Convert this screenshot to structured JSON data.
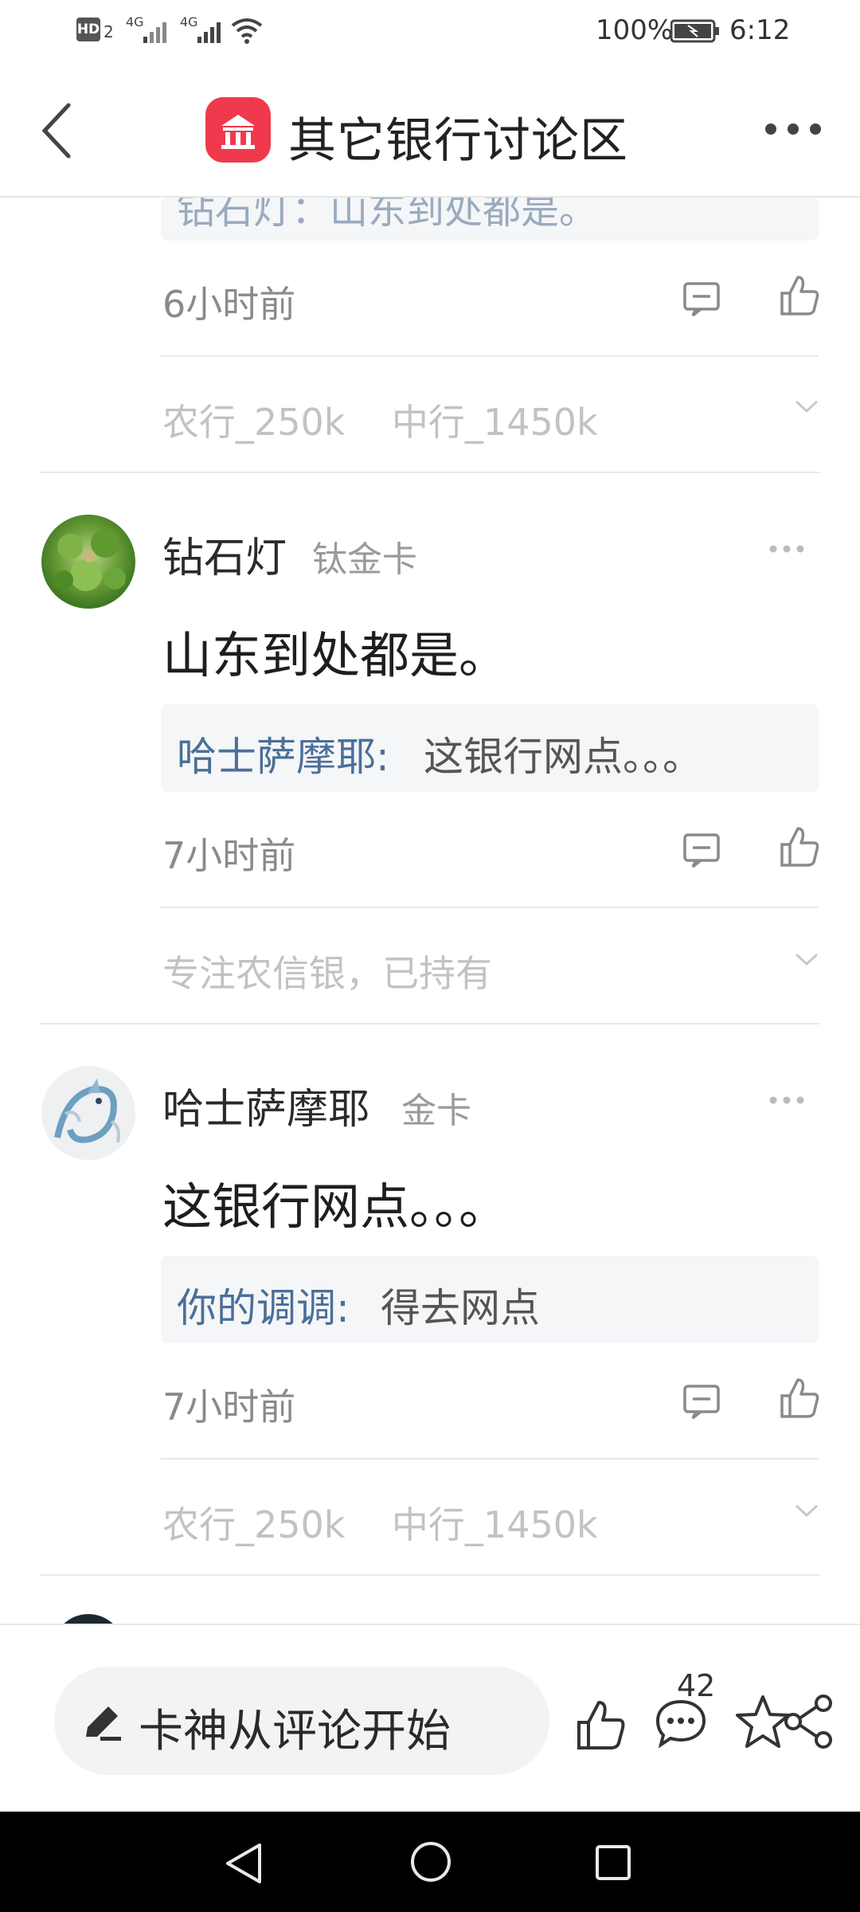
{
  "status_bar": {
    "hd_label": "HD",
    "hd_sub": "2",
    "net1": "4G",
    "net2": "4G",
    "battery_pct": "100%",
    "time": "6:12"
  },
  "header": {
    "title": "其它银行讨论区"
  },
  "top_partial": {
    "reply_text": "钻石灯：山东到处都是。",
    "time": "6小时前",
    "signature": "农行_250k    中行_1450k"
  },
  "comments": [
    {
      "user": "钻石灯",
      "badge": "钛金卡",
      "text": "山东到处都是。",
      "reply_name": "哈士萨摩耶:",
      "reply_text": "这银行网点。。。",
      "time": "7小时前",
      "signature": "专注农信银，已持有"
    },
    {
      "user": "哈士萨摩耶",
      "badge": "金卡",
      "text": "这银行网点。。。",
      "reply_name": "你的调调:",
      "reply_text": "得去网点",
      "time": "7小时前",
      "signature": "农行_250k    中行_1450k"
    }
  ],
  "bottom_bar": {
    "input_placeholder": "卡神从评论开始",
    "comment_count": "42"
  },
  "icons": {
    "back": "chevron-left-icon",
    "menu": "more-dots-icon",
    "reply": "comment-icon",
    "like": "thumbs-up-icon",
    "expand": "chevron-down-icon",
    "edit": "pencil-icon",
    "star": "star-icon",
    "share": "share-icon"
  },
  "colors": {
    "brand": "#f0394d",
    "reply_name": "#4b6f98"
  }
}
